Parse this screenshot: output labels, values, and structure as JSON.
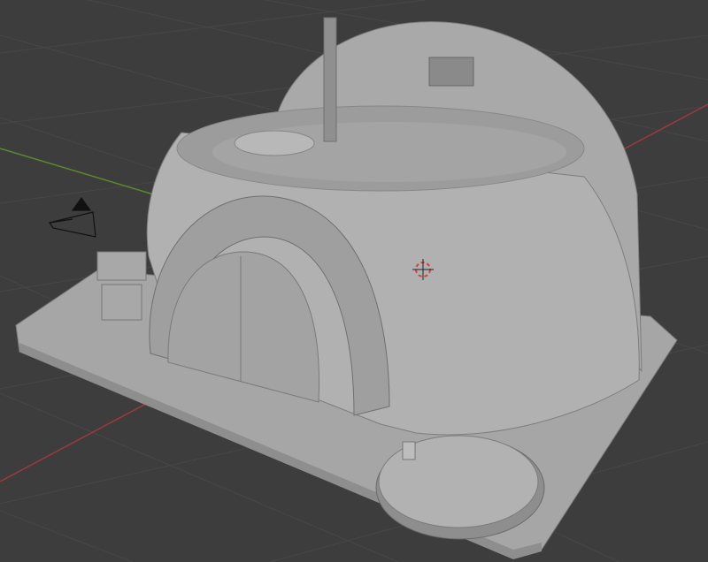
{
  "viewport": {
    "mode": "3D viewport",
    "colors": {
      "background": "#3d3d3d",
      "grid": "#474747",
      "x_axis": "#9c3a3f",
      "y_axis": "#5c8a2e",
      "model_light": "#b4b4b4",
      "model_mid": "#9a9a9a",
      "model_dark": "#6e6e6e"
    },
    "icons": [
      "camera-object-icon",
      "3d-cursor-icon"
    ]
  }
}
